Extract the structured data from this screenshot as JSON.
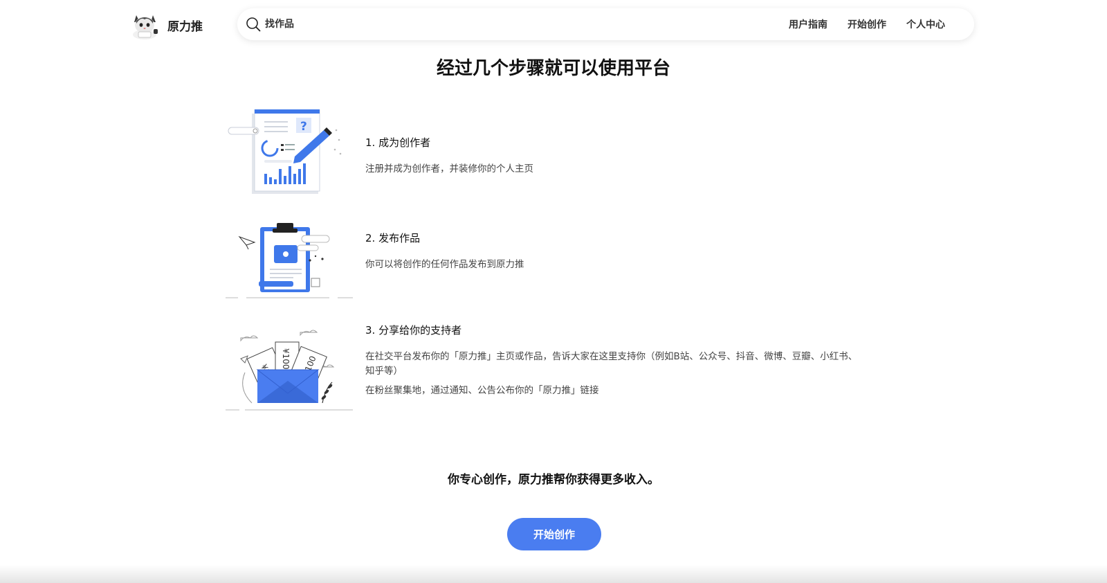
{
  "brand": {
    "name": "原力推",
    "logo_icon": "cat-mascot-icon"
  },
  "search": {
    "placeholder": "找作品",
    "value": "",
    "icon": "search-icon"
  },
  "nav": {
    "items": [
      {
        "label": "用户指南"
      },
      {
        "label": "开始创作"
      },
      {
        "label": "个人中心"
      }
    ]
  },
  "main": {
    "title": "经过几个步骤就可以使用平台",
    "steps": [
      {
        "title": "1. 成为创作者",
        "desc": "注册并成为创作者，并装修你的个人主页",
        "illustration": "report-chart-pencil-illustration"
      },
      {
        "title": "2. 发布作品",
        "desc": "你可以将创作的任何作品发布到原力推",
        "illustration": "clipboard-folder-illustration"
      },
      {
        "title": "3. 分享给你的支持者",
        "desc1": "在社交平台发布你的「原力推」主页或作品，告诉大家在这里支持你（例如B站、公众号、抖音、微博、豆瓣、小红书、知乎等）",
        "desc2": "在粉丝聚集地，通过通知、公告公布你的「原力推」链接",
        "illustration": "envelope-money-illustration"
      }
    ],
    "tagline": "你专心创作，原力推帮你获得更多收入。",
    "cta_label": "开始创作"
  },
  "colors": {
    "accent": "#4a7df0",
    "text": "#222222",
    "background": "#ffffff"
  }
}
